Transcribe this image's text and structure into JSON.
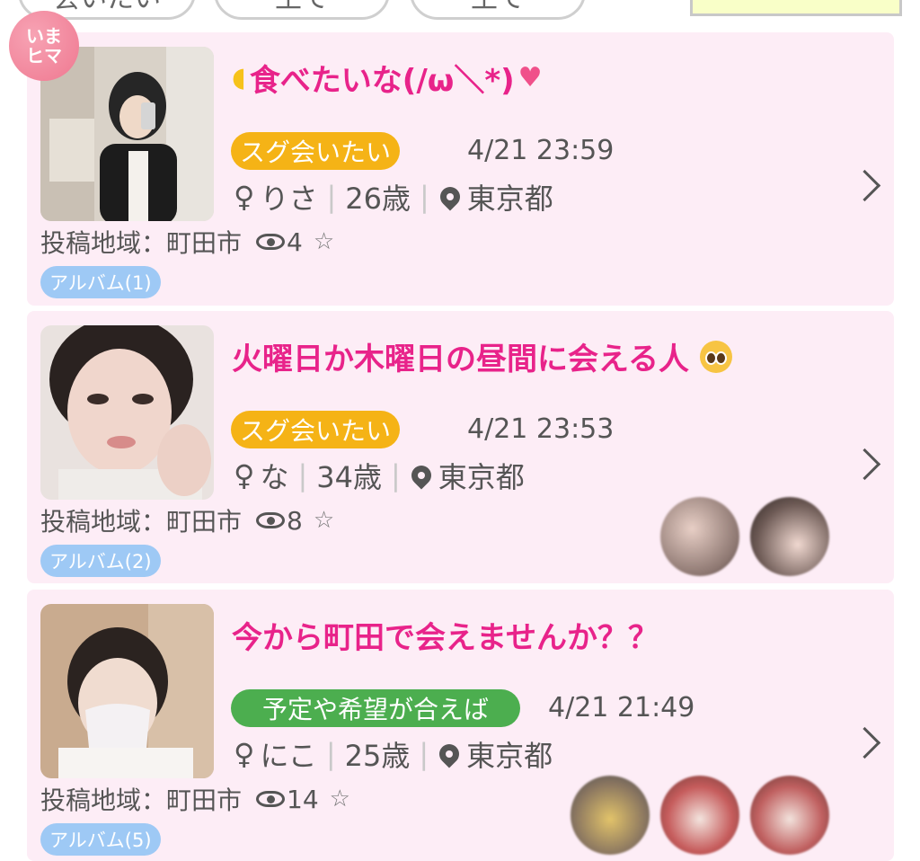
{
  "filters": [
    "会いたい",
    "土で",
    "土で"
  ],
  "posts": [
    {
      "title": "食べたいな(/ω＼*)",
      "hima_badge": [
        "いま",
        "ヒマ"
      ],
      "status": "スグ会いたい",
      "status_color": "#f5b316",
      "datetime": "4/21 23:59",
      "gender_icon": "♀",
      "name": "りさ",
      "age": "26歳",
      "location": "東京都",
      "region": "投稿地域：町田市",
      "views": "4",
      "star": "☆",
      "album": "アルバム(1)",
      "emoji_prefix": "banana-emoji",
      "emoji_suffix": "sparkling-heart-emoji"
    },
    {
      "title": "火曜日か木曜日の昼間に会える人",
      "status": "スグ会いたい",
      "status_color": "#f5b316",
      "datetime": "4/21 23:53",
      "gender_icon": "♀",
      "name": "な",
      "age": "34歳",
      "location": "東京都",
      "region": "投稿地域：町田市",
      "views": "8",
      "star": "☆",
      "album": "アルバム(2)",
      "emoji_suffix": "pleading-face-emoji"
    },
    {
      "title": "今から町田で会えませんか？？",
      "status": "予定や希望が合えば",
      "status_color": "#4cae4f",
      "datetime": "4/21 21:49",
      "gender_icon": "♀",
      "name": "にこ",
      "age": "25歳",
      "location": "東京都",
      "region": "投稿地域：町田市",
      "views": "14",
      "star": "☆",
      "album": "アルバム(5)"
    }
  ]
}
